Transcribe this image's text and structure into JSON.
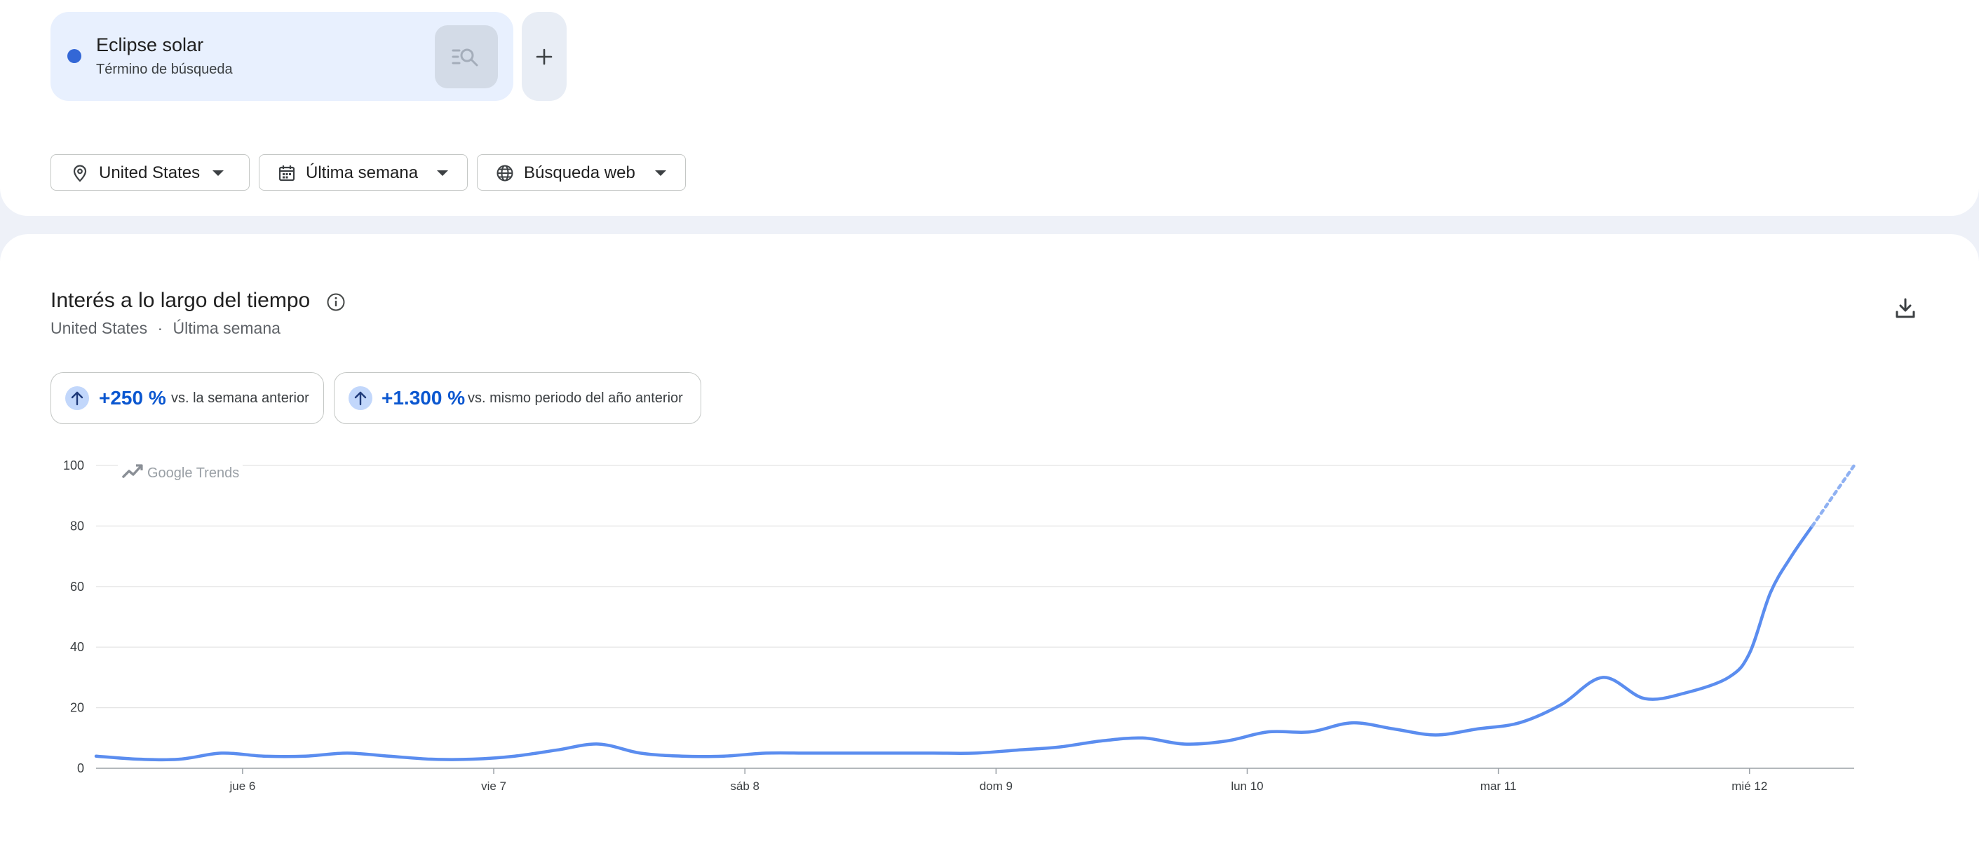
{
  "term": {
    "name": "Eclipse solar",
    "type": "Término de búsqueda",
    "color": "#3367d6",
    "search_icon": "search-list-icon",
    "add_label": "+"
  },
  "filters": [
    {
      "label": "United States",
      "icon": "location-pin-icon"
    },
    {
      "label": "Última semana",
      "icon": "calendar-icon"
    },
    {
      "label": "Búsqueda web",
      "icon": "globe-icon"
    }
  ],
  "section": {
    "title": "Interés a lo largo del tiempo",
    "region": "United States",
    "separator": "·",
    "period": "Última semana"
  },
  "stats": [
    {
      "value": "+250 %",
      "label": "vs. la semana anterior"
    },
    {
      "value": "+1.300 %",
      "label": "vs. mismo periodo del año anterior"
    }
  ],
  "watermark": "Google Trends",
  "chart_data": {
    "type": "line",
    "title": "",
    "xlabel": "",
    "ylabel": "",
    "ylim": [
      0,
      100
    ],
    "y_ticks": [
      "0",
      "20",
      "40",
      "60",
      "80",
      "100"
    ],
    "x_tick_labels": [
      "jue 6",
      "vie 7",
      "sáb 8",
      "dom 9",
      "lun 10",
      "mar 11",
      "mié 12"
    ],
    "x_tick_hours": [
      24,
      48,
      72,
      96,
      120,
      144,
      168
    ],
    "series": [
      {
        "color": "#5b8def",
        "x_hours": [
          10,
          14,
          18,
          22,
          26,
          30,
          34,
          38,
          42,
          46,
          50,
          54,
          58,
          62,
          66,
          70,
          74,
          78,
          82,
          86,
          90,
          94,
          98,
          102,
          106,
          110,
          114,
          118,
          122,
          126,
          130,
          134,
          138,
          142,
          146,
          150,
          154,
          158,
          162,
          166,
          168,
          170,
          172,
          174
        ],
        "values": [
          4,
          3,
          3,
          5,
          4,
          4,
          5,
          4,
          3,
          3,
          4,
          6,
          8,
          5,
          4,
          4,
          5,
          5,
          5,
          5,
          5,
          5,
          6,
          7,
          9,
          10,
          8,
          9,
          12,
          12,
          15,
          13,
          11,
          13,
          15,
          21,
          30,
          23,
          25,
          30,
          38,
          58,
          70,
          80
        ],
        "projected_x_hours": [
          174,
          178
        ],
        "projected_values": [
          80,
          100
        ]
      }
    ],
    "grid": true
  }
}
